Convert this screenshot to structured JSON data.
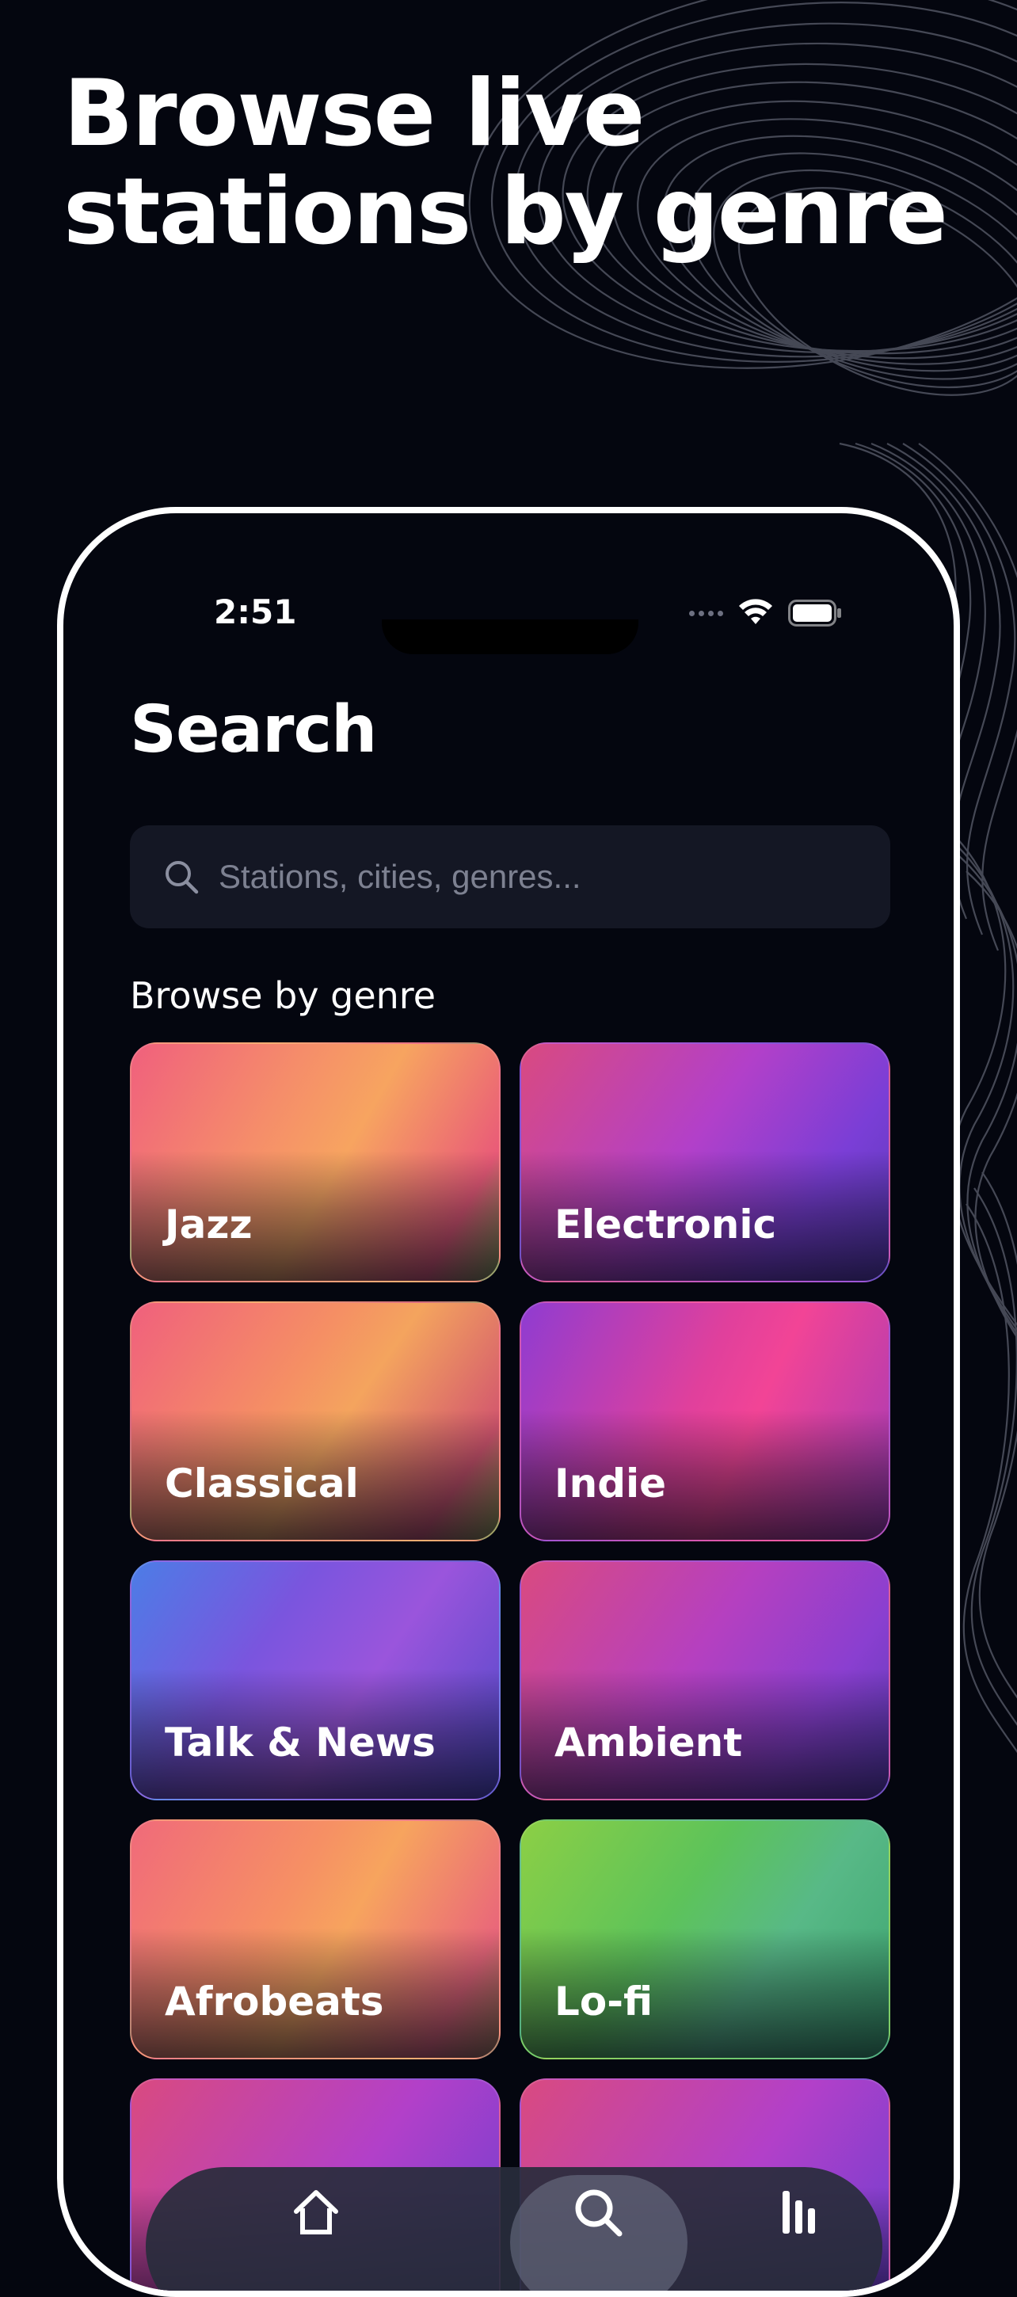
{
  "headline": {
    "line1": "Browse live",
    "line2": "stations by genre"
  },
  "status_bar": {
    "time": "2:51",
    "wifi_icon": "wifi-icon",
    "battery_icon": "battery-icon"
  },
  "screen": {
    "title": "Search",
    "search": {
      "placeholder": "Stations, cities, genres...",
      "value": "",
      "icon": "search-icon"
    },
    "section_title": "Browse by genre",
    "genres": [
      {
        "label": "Jazz"
      },
      {
        "label": "Electronic"
      },
      {
        "label": "Classical"
      },
      {
        "label": "Indie"
      },
      {
        "label": "Talk & News"
      },
      {
        "label": "Ambient"
      },
      {
        "label": "Afrobeats"
      },
      {
        "label": "Lo-fi"
      }
    ]
  },
  "tab_bar": {
    "icons": [
      "home-icon",
      "search-icon",
      "library-icon"
    ],
    "selected": "search-icon"
  },
  "colors": {
    "background": "#04060f",
    "search_field": "#141724",
    "placeholder_text": "#7d8191"
  }
}
